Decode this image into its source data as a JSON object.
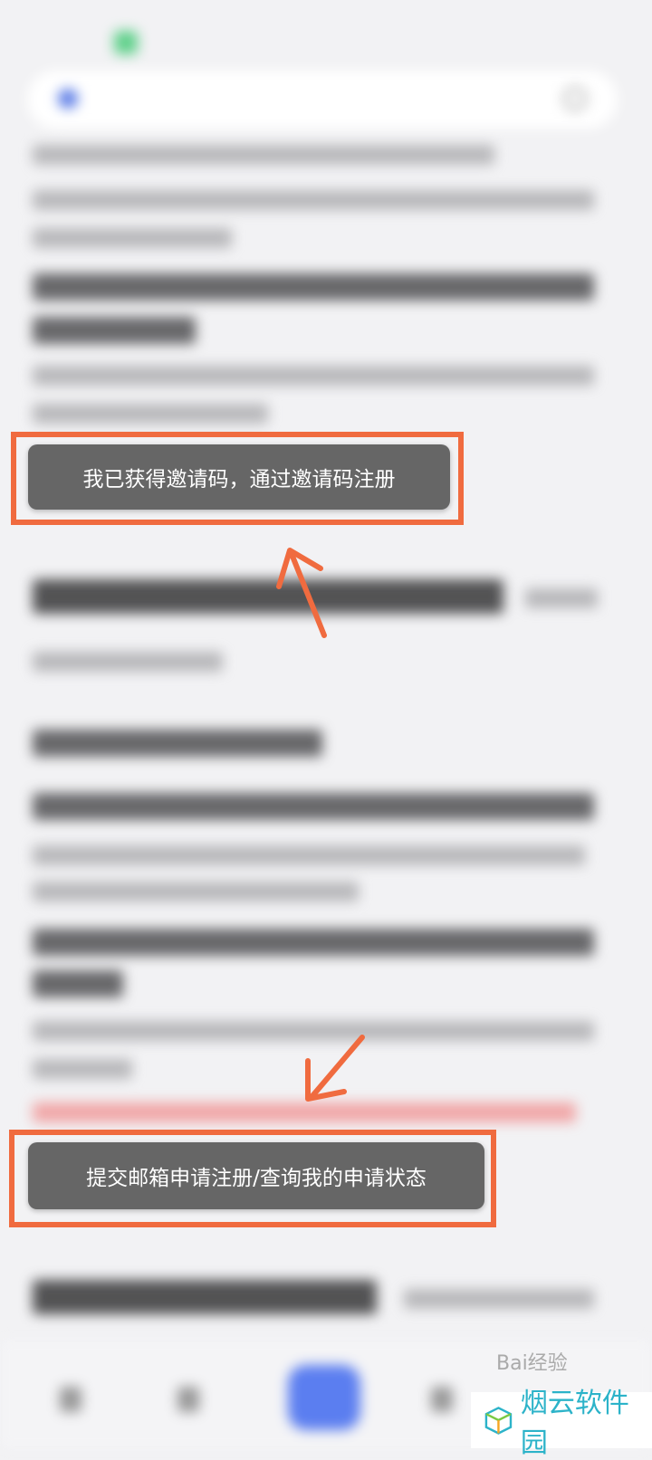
{
  "buttons": {
    "invite_code": "我已获得邀请码，通过邀请码注册",
    "email_apply": "提交邮箱申请注册/查询我的申请状态"
  },
  "watermark": {
    "brand": "烟云软件园",
    "baidu": "Bai经验"
  },
  "colors": {
    "highlight": "#f06b3f",
    "button_bg": "#666666",
    "watermark_text": "#2cb3c9"
  }
}
